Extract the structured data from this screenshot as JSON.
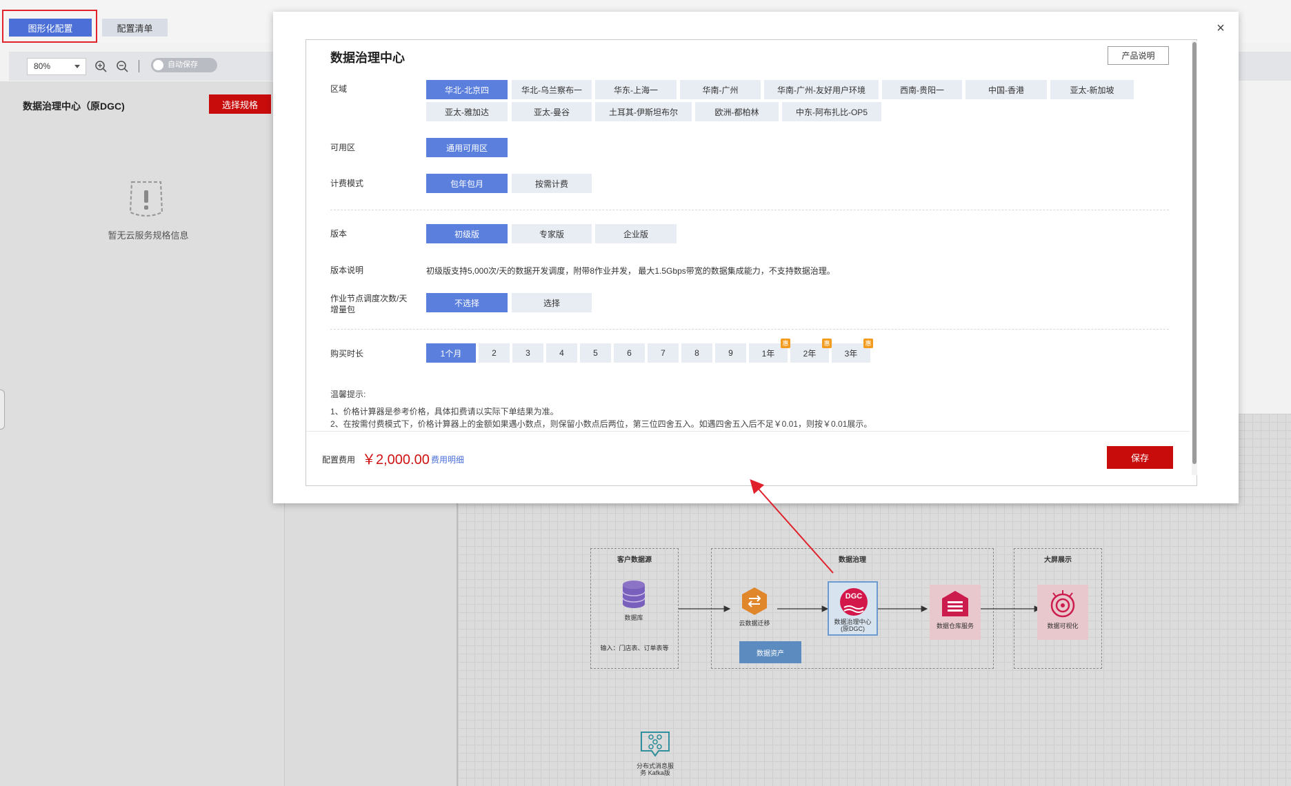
{
  "tabs": {
    "graphic": "图形化配置",
    "list": "配置清单"
  },
  "toolbar": {
    "zoom": "80%",
    "autosave": "自动保存"
  },
  "left_panel": {
    "service_title": "数据治理中心（原DGC)",
    "choose_spec": "选择规格",
    "empty_text": "暂无云服务规格信息"
  },
  "modal": {
    "title": "数据治理中心",
    "product_button": "产品说明",
    "region": {
      "label": "区域",
      "options": [
        "华北-北京四",
        "华北-乌兰察布一",
        "华东-上海一",
        "华南-广州",
        "华南-广州-友好用户环境",
        "西南-贵阳一",
        "中国-香港",
        "亚太-新加坡",
        "亚太-雅加达",
        "亚太-曼谷",
        "土耳其-伊斯坦布尔",
        "欧洲-都柏林",
        "中东-阿布扎比-OP5"
      ],
      "selected": "华北-北京四"
    },
    "az": {
      "label": "可用区",
      "options": [
        "通用可用区"
      ],
      "selected": "通用可用区"
    },
    "billing": {
      "label": "计费模式",
      "options": [
        "包年包月",
        "按需计费"
      ],
      "selected": "包年包月"
    },
    "edition": {
      "label": "版本",
      "options": [
        "初级版",
        "专家版",
        "企业版"
      ],
      "selected": "初级版"
    },
    "edition_desc": {
      "label": "版本说明",
      "text": "初级版支持5,000次/天的数据开发调度，附带8作业并发， 最大1.5Gbps带宽的数据集成能力，不支持数据治理。"
    },
    "addon": {
      "label_line1": "作业节点调度次数/天",
      "label_line2": "增量包",
      "options": [
        "不选择",
        "选择"
      ],
      "selected": "不选择"
    },
    "duration": {
      "label": "购买时长",
      "options": [
        "1个月",
        "2",
        "3",
        "4",
        "5",
        "6",
        "7",
        "8",
        "9",
        "1年",
        "2年",
        "3年"
      ],
      "selected": "1个月",
      "badge": "惠"
    },
    "tips": {
      "title": "温馨提示:",
      "line1": "1、价格计算器是参考价格，具体扣费请以实际下单结果为准。",
      "line2": "2、在按需付费模式下，价格计算器上的金额如果遇小数点，则保留小数点后两位，第三位四舍五入。如遇四舍五入后不足￥0.01，则按￥0.01展示。"
    },
    "footer": {
      "cost_label": "配置费用",
      "cost_value": "￥2,000.00",
      "cost_detail": "费用明细",
      "save": "保存"
    },
    "close": "×"
  },
  "diagram": {
    "groups": {
      "source": "客户数据源",
      "governance": "数据治理",
      "screen": "大屏展示"
    },
    "nodes": {
      "database": "数据库",
      "input": "输入：门店表、订单表等",
      "migration": "云数据迁移",
      "dgc_line1": "数据治理中心",
      "dgc_line2": "(原DGC)",
      "dgc_icon": "DGC",
      "assets": "数据资产",
      "warehouse": "数据仓库服务",
      "visual": "数据可视化",
      "kafka_line1": "分布式消息服",
      "kafka_line2": "务 Kafka版"
    }
  },
  "colors": {
    "accent": "#5b7fdd",
    "danger": "#c80c0c",
    "badge": "#f39b1e"
  }
}
